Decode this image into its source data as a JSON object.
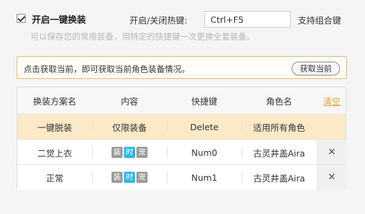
{
  "header": {
    "enable_label": "开启一键换装",
    "enable_checked": true,
    "hotkey_label": "开启/关闭热键:",
    "hotkey_value": "Ctrl+F5",
    "combo_label": "支持组合键",
    "description": "可以保存您的常用装备，用特定的快捷键一次更换全套装备。"
  },
  "notice": {
    "text": "点击获取当前，即可获取当前角色装备情况。",
    "button_label": "获取当前"
  },
  "table": {
    "headers": [
      "换装方案名",
      "内容",
      "快捷键",
      "角色名"
    ],
    "clear_label": "清空",
    "rows": [
      {
        "name": "一键脱装",
        "content": "仅限装备",
        "hotkey": "Delete",
        "role": "适用所有角色",
        "tags": [],
        "deletable": false
      },
      {
        "name": "二觉上衣",
        "content": "",
        "hotkey": "Num0",
        "role": "古灵井盖Aira",
        "tags": [
          "装",
          "时",
          "宠"
        ],
        "deletable": true
      },
      {
        "name": "正常",
        "content": "",
        "hotkey": "Num1",
        "role": "古灵井盖Aira",
        "tags": [
          "装",
          "时",
          "宠"
        ],
        "deletable": true
      }
    ],
    "delete_symbol": "✕",
    "colors": {
      "selected_row": "#fbe9c8",
      "tag_gray": "#9a9a9a",
      "tag_blue": "#29b7e6",
      "link": "#e8a23a"
    }
  }
}
